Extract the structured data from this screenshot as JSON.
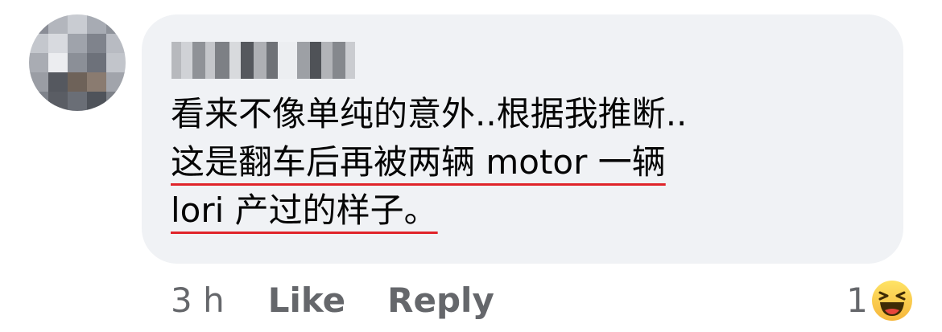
{
  "comment": {
    "author_name": "",
    "text_lines": [
      "看来不像单纯的意外..根据我推断..",
      "这是翻车后再被两辆 motor 一辆",
      "lori 产过的样子。"
    ],
    "timestamp": "3 h",
    "like_label": "Like",
    "reply_label": "Reply",
    "reaction_count": "1",
    "reaction_icon": "haha-emoji-icon",
    "underline_color": "#e0242a"
  }
}
